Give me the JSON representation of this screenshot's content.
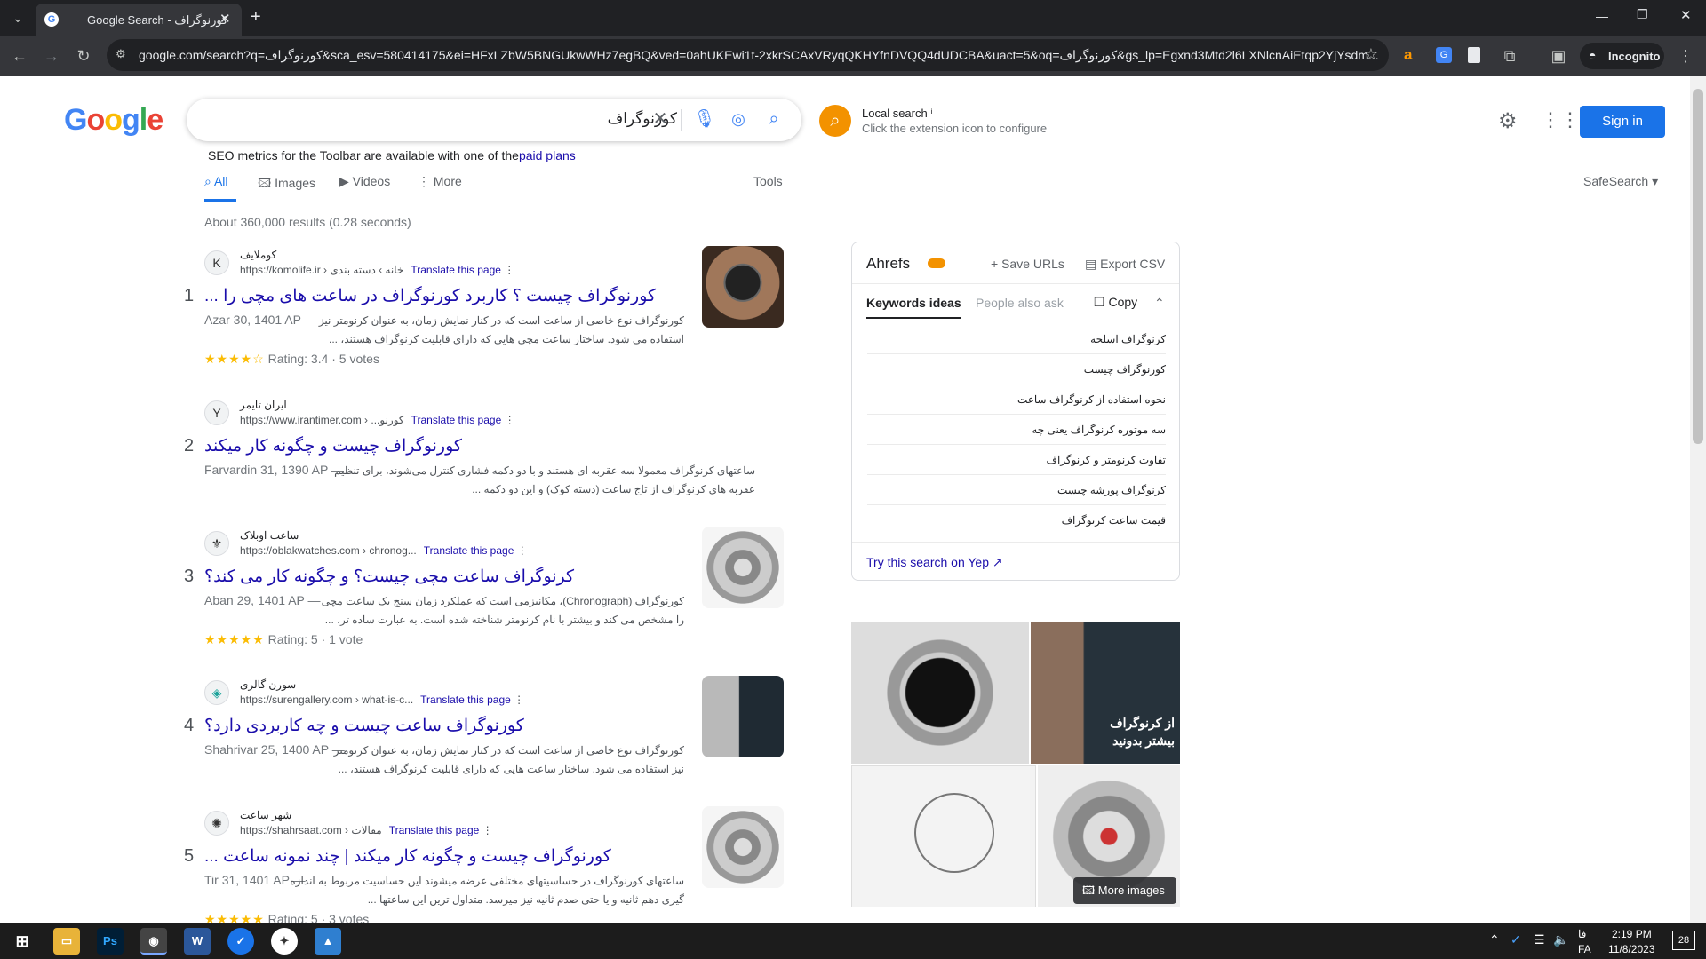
{
  "browser": {
    "tab_title": "Google Search - کورنوگراف",
    "url": "google.com/search?q=کورنوگراف&sca_esv=580414175&ei=HFxLZbW5BNGUkwWHz7egBQ&ved=0ahUKEwi1t-2xkrSCAxVRyqQKHYfnDVQQ4dUDCBA&uact=5&oq=کورنوگراف&gs_lp=Egxnd3Mtd2l6LXNlcnAiEtqp2YjYsdm...",
    "incognito_label": "Incognito",
    "icons": [
      "back-icon",
      "forward-icon",
      "reload-icon",
      "star-icon",
      "extensions-icon",
      "menu-icon"
    ]
  },
  "search": {
    "query": "کورنوگراف",
    "logo": "Google",
    "local_search_title": "Local search ⁱ",
    "local_search_sub": "Click the extension icon to configure",
    "signin": "Sign in",
    "seo_text": "SEO metrics for the Toolbar are available with one of the",
    "seo_link": "paid plans",
    "tabs": [
      "All",
      "Images",
      "Videos",
      "More"
    ],
    "tools": "Tools",
    "safesearch": "SafeSearch",
    "stats": "About 360,000 results (0.28 seconds)"
  },
  "results": [
    {
      "num": "1",
      "site": "کوملایف",
      "url": "https://komolife.ir › خانه › دسته بندی",
      "translate": "Translate this page",
      "title": "کورنوگراف چیست ؟ کاربرد کورنوگراف در ساعت های مچی را ...",
      "date": "Azar 30, 1401 AP —",
      "snippet1": "کورنوگراف نوع خاصی از ساعت است که در کنار نمایش زمان، به عنوان کرنومتر نیز",
      "snippet2": "استفاده می شود. ساختار ساعت مچی هایی که دارای قابلیت کرنوگراف هستند، ...",
      "stars": "★★★★☆",
      "rating": "Rating: 3.4 · 5 votes"
    },
    {
      "num": "2",
      "site": "ایران تایمر",
      "url": "https://www.irantimer.com › ...کورنو",
      "translate": "Translate this page",
      "title": "کورنوگراف چیست و چگونه کار میکند",
      "date": "Farvardin 31, 1390 AP —",
      "snippet1": "ساعتهای کرنوگراف معمولا سه عقربه ای هستند و با دو دکمه فشاری کنترل می‌شوند، برای تنظیم",
      "snippet2": "عقربه های کرنوگراف از تاج ساعت (دسته کوک) و این دو دکمه ...",
      "stars": "",
      "rating": ""
    },
    {
      "num": "3",
      "site": "ساعت اوبلاک",
      "url": "https://oblakwatches.com › chronog...",
      "translate": "Translate this page",
      "title": "کرنوگراف ساعت مچی چیست؟ و چگونه کار می کند؟",
      "date": "Aban 29, 1401 AP —",
      "snippet1": "کورنوگراف (Chronograph)، مکانیزمی است که عملکرد زمان سنج یک ساعت مچی",
      "snippet2": "را مشخص می کند و بیشتر با نام کرنومتر شناخته شده است. به عبارت ساده تر، ...",
      "stars": "★★★★★",
      "rating": "Rating: 5 · 1 vote"
    },
    {
      "num": "4",
      "site": "سورن گالری",
      "url": "https://surengallery.com › what-is-c...",
      "translate": "Translate this page",
      "title": "کورنوگراف ساعت چیست و چه کاربردی دارد؟",
      "date": "Shahrivar 25, 1400 AP —",
      "snippet1": "کورنوگراف نوع خاصی از ساعت است که در کنار نمایش زمان، به عنوان کرنومتر",
      "snippet2": "نیز استفاده می شود. ساختار ساعت هایی که دارای قابلیت کرنوگراف هستند، ...",
      "stars": "",
      "rating": ""
    },
    {
      "num": "5",
      "site": "شهر ساعت",
      "url": "https://shahrsaat.com › مقالات",
      "translate": "Translate this page",
      "title": "کورنوگراف چیست و چگونه کار میکند | چند نمونه ساعت ...",
      "date": "Tir 31, 1401 AP —",
      "snippet1": "ساعتهای کورنوگراف در حساسیتهای مختلفی عرضه میشوند این حساسیت مربوط به اندازه",
      "snippet2": "گیری دهم ثانیه و یا حتی صدم ثانیه نیز میرسد. متداول ترین این ساعتها ...",
      "stars": "★★★★★",
      "rating": "Rating: 5 · 3 votes"
    }
  ],
  "ahrefs": {
    "brand": "Ahrefs",
    "save_urls": "Save URLs",
    "export_csv": "Export CSV",
    "tab_keywords": "Keywords ideas",
    "tab_people": "People also ask",
    "copy": "Copy",
    "keywords": [
      "کرنوگراف اسلحه",
      "کورنوگراف چیست",
      "نحوه استفاده از کرنوگراف ساعت",
      "سه موتوره کرنوگراف یعنی چه",
      "تفاوت کرنومتر و کرنوگراف",
      "کرنوگراف پورشه چیست",
      "قیمت ساعت کرنوگراف"
    ],
    "yep": "Try this search on Yep"
  },
  "images_panel": {
    "overlay_text1": "از کرنوگراف",
    "overlay_text2": "بیشتر بدونید",
    "more_images": "More images"
  },
  "taskbar": {
    "lang1": "فا",
    "lang2": "FA",
    "time": "2:19 PM",
    "date": "11/8/2023",
    "notifications": "28"
  },
  "colors": {
    "link": "#1a0dab",
    "google_blue": "#4285f4",
    "google_red": "#ea4335",
    "google_yellow": "#fbbc05",
    "google_green": "#34a853",
    "ahrefs_orange": "#f39200"
  }
}
